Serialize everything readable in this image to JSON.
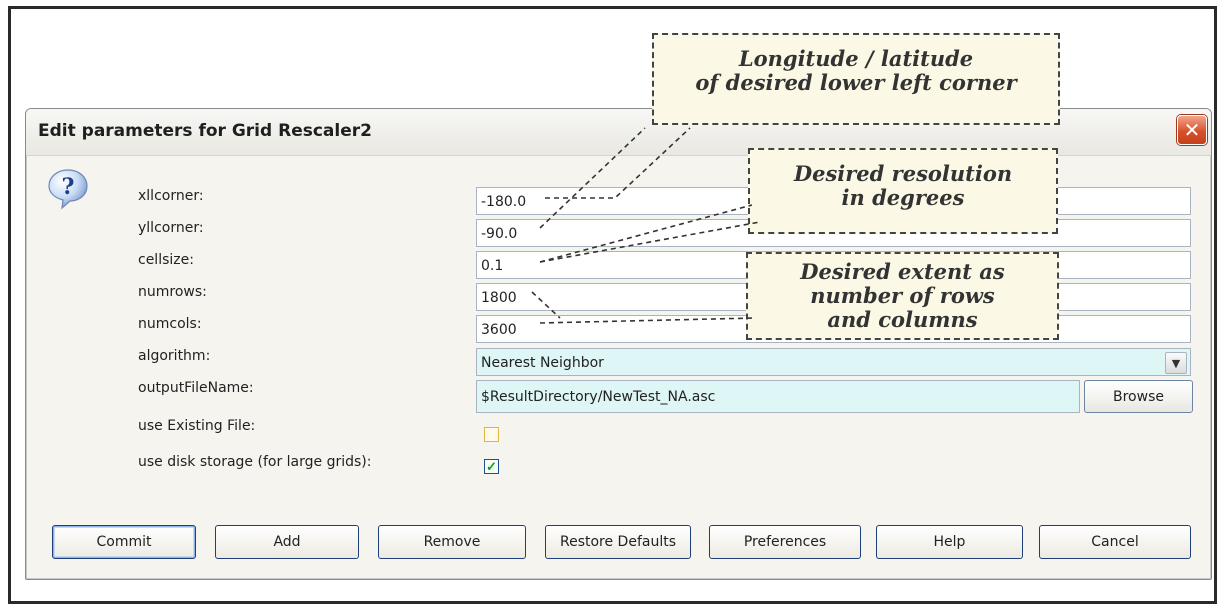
{
  "dialog": {
    "title": "Edit parameters for Grid Rescaler2",
    "close_symbol": "✕"
  },
  "fields": [
    {
      "label": "xllcorner:",
      "value": "-180.0"
    },
    {
      "label": "yllcorner:",
      "value": "-90.0"
    },
    {
      "label": "cellsize:",
      "value": "0.1"
    },
    {
      "label": "numrows:",
      "value": "1800"
    },
    {
      "label": "numcols:",
      "value": "3600"
    }
  ],
  "algorithm": {
    "label": "algorithm:",
    "selected": "Nearest Neighbor"
  },
  "output_file": {
    "label": "outputFileName:",
    "value": "$ResultDirectory/NewTest_NA.asc",
    "browse_label": "Browse"
  },
  "use_existing_file": {
    "label": "use Existing File:",
    "checked": false
  },
  "use_disk_storage": {
    "label": "use disk storage (for large grids):",
    "checked": true,
    "check_mark": "✓"
  },
  "buttons": {
    "commit": "Commit",
    "add": "Add",
    "remove": "Remove",
    "restore_defaults": "Restore Defaults",
    "preferences": "Preferences",
    "help": "Help",
    "cancel": "Cancel"
  },
  "callouts": {
    "lower_left": [
      "Longitude / latitude",
      "of desired lower left corner"
    ],
    "resolution": [
      "Desired resolution",
      "in degrees"
    ],
    "extent": [
      "Desired extent as",
      "number of rows",
      "and columns"
    ]
  },
  "icons": {
    "question": "question-icon",
    "close": "close-icon",
    "dropdown": "chevron-down-icon"
  },
  "colors": {
    "select_bg": "#dff6f6",
    "close_red": "#d9512c",
    "callout_bg": "#fbf9e6"
  }
}
